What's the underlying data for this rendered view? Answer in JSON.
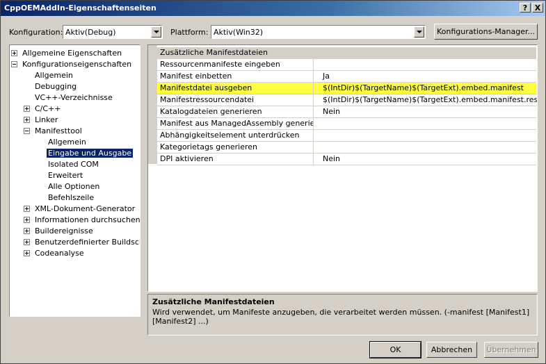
{
  "window": {
    "title": "CppOEMAddIn-Eigenschaftenseiten",
    "help_glyph": "?",
    "close_glyph": "X"
  },
  "toolbar": {
    "config_label": "Konfiguration:",
    "config_value": "Aktiv(Debug)",
    "platform_label": "Plattform:",
    "platform_value": "Aktiv(Win32)",
    "config_manager_label": "Konfigurations-Manager..."
  },
  "tree": {
    "items": [
      {
        "label": "Allgemeine Eigenschaften"
      },
      {
        "label": "Konfigurationseigenschaften"
      },
      {
        "label": "Allgemein"
      },
      {
        "label": "Debugging"
      },
      {
        "label": "VC++-Verzeichnisse"
      },
      {
        "label": "C/C++"
      },
      {
        "label": "Linker"
      },
      {
        "label": "Manifesttool"
      },
      {
        "label": "Allgemein"
      },
      {
        "label": "Eingabe und Ausgabe"
      },
      {
        "label": "Isolated COM"
      },
      {
        "label": "Erweitert"
      },
      {
        "label": "Alle Optionen"
      },
      {
        "label": "Befehlszeile"
      },
      {
        "label": "XML-Dokument-Generator"
      },
      {
        "label": "Informationen durchsuchen"
      },
      {
        "label": "Buildereignisse"
      },
      {
        "label": "Benutzerdefinierter Buildschritt"
      },
      {
        "label": "Codeanalyse"
      }
    ]
  },
  "grid": {
    "rows": [
      {
        "name": "Zusätzliche Manifestdateien",
        "value": ""
      },
      {
        "name": "Ressourcenmanifeste eingeben",
        "value": ""
      },
      {
        "name": "Manifest einbetten",
        "value": "Ja"
      },
      {
        "name": "Manifestdatei ausgeben",
        "value": "$(IntDir)$(TargetName)$(TargetExt).embed.manifest"
      },
      {
        "name": "Manifestressourcendatei",
        "value": "$(IntDir)$(TargetName)$(TargetExt).embed.manifest.res"
      },
      {
        "name": "Katalogdateien generieren",
        "value": "Nein"
      },
      {
        "name": "Manifest aus ManagedAssembly generieren",
        "value": ""
      },
      {
        "name": "Abhängigkeitselement unterdrücken",
        "value": ""
      },
      {
        "name": "Kategorietags generieren",
        "value": ""
      },
      {
        "name": "DPI aktivieren",
        "value": "Nein"
      }
    ]
  },
  "description": {
    "title": "Zusätzliche Manifestdateien",
    "text": "Wird verwendet, um Manifeste anzugeben, die verarbeitet werden müssen. (-manifest [Manifest1] [Manifest2] ...)"
  },
  "buttons": {
    "ok": "OK",
    "cancel": "Abbrechen",
    "apply": "Übernehmen"
  },
  "colors": {
    "highlight_row": "#ffff40",
    "selection": "#0a246a"
  }
}
